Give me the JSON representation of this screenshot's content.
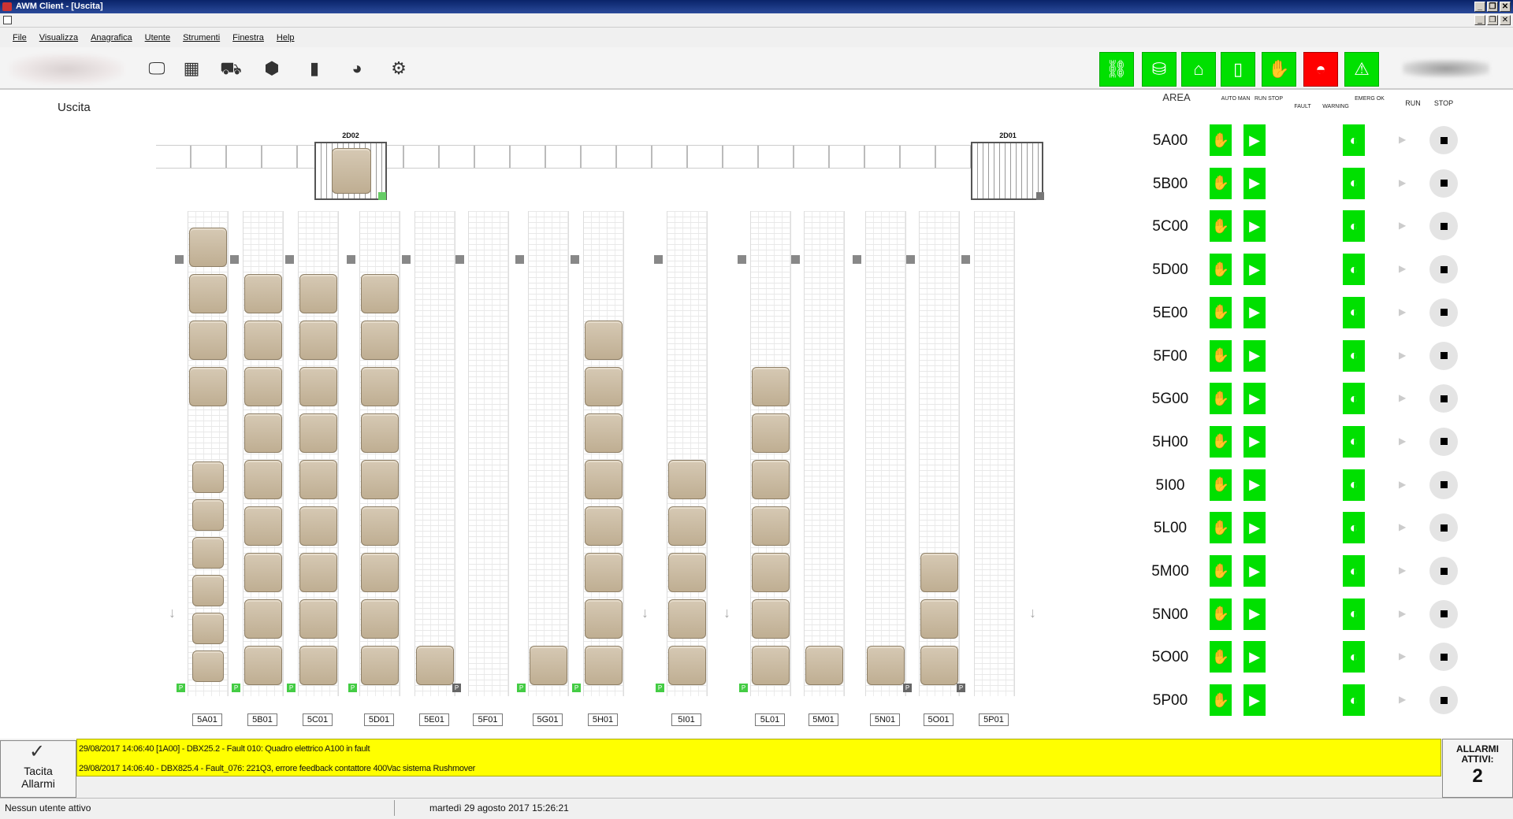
{
  "window": {
    "title": "AWM Client - [Uscita]"
  },
  "menu": [
    "File",
    "Visualizza",
    "Anagrafica",
    "Utente",
    "Strumenti",
    "Finestra",
    "Help"
  ],
  "page": {
    "title": "Uscita"
  },
  "shuttles": [
    {
      "label": "2D02"
    },
    {
      "label": "2D01"
    }
  ],
  "columns": [
    {
      "label": "5A01",
      "boxes": [
        7,
        8,
        9,
        10,
        11,
        12,
        13,
        14,
        15,
        16
      ],
      "indicator": "P"
    },
    {
      "label": "5B01",
      "boxes": [
        8,
        9,
        10,
        11,
        12,
        13,
        14,
        15,
        16
      ],
      "indicator": "P"
    },
    {
      "label": "5C01",
      "boxes": [
        8,
        9,
        10,
        11,
        12,
        13,
        14,
        15,
        16
      ],
      "indicator": "P"
    },
    {
      "label": "5D01",
      "boxes": [
        8,
        9,
        10,
        11,
        12,
        13,
        14,
        15,
        16
      ],
      "indicator": "P"
    },
    {
      "label": "5E01",
      "boxes": [
        16
      ],
      "indicator": "P"
    },
    {
      "label": "5F01",
      "boxes": [],
      "indicator": ""
    },
    {
      "label": "5G01",
      "boxes": [
        16
      ],
      "indicator": "P"
    },
    {
      "label": "5H01",
      "boxes": [
        9,
        10,
        11,
        12,
        13,
        14,
        15,
        16
      ],
      "indicator": "P"
    },
    {
      "label": "5I01",
      "boxes": [
        12,
        13,
        14,
        15,
        16
      ],
      "indicator": "P"
    },
    {
      "label": "5L01",
      "boxes": [
        10,
        11,
        12,
        13,
        14,
        15,
        16
      ],
      "indicator": "P"
    },
    {
      "label": "5M01",
      "boxes": [
        16
      ],
      "indicator": ""
    },
    {
      "label": "5N01",
      "boxes": [
        16
      ],
      "indicator": "P"
    },
    {
      "label": "5O01",
      "boxes": [
        14,
        15,
        16
      ],
      "indicator": "P"
    },
    {
      "label": "5P01",
      "boxes": [],
      "indicator": ""
    }
  ],
  "area_panel": {
    "headers": {
      "area": "AREA",
      "auto": "AUTO MAN",
      "run": "RUN STOP",
      "fault": "FAULT",
      "warning": "WARNING",
      "emerg": "EMERG OK",
      "runcol": "RUN",
      "stop": "STOP"
    },
    "rows": [
      "5A00",
      "5B00",
      "5C00",
      "5D00",
      "5E00",
      "5F00",
      "5G00",
      "5H00",
      "5I00",
      "5L00",
      "5M00",
      "5N00",
      "5O00",
      "5P00"
    ]
  },
  "alarms": {
    "button_line1": "Tacita",
    "button_line2": "Allarmi",
    "items": [
      "29/08/2017 14:06:40 [1A00] - DBX25.2 - Fault 010: Quadro elettrico A100 in fault",
      "29/08/2017 14:06:40 - DBX825.4 - Fault_076: 221Q3, errore feedback contattore 400Vac sistema Rushmover"
    ],
    "active_label": "ALLARMI ATTIVI:",
    "active_count": "2"
  },
  "status": {
    "user": "Nessun utente attivo",
    "datetime": "martedì 29 agosto 2017 15:26:21"
  }
}
